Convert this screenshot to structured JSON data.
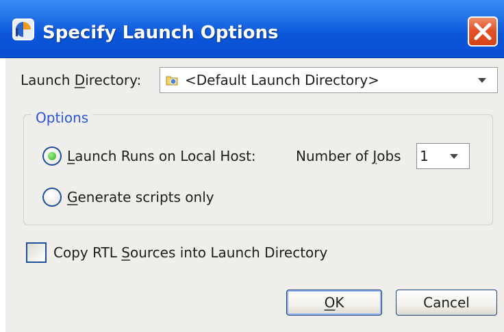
{
  "window": {
    "title": "Specify Launch Options",
    "icons": {
      "app": "app-icon",
      "close": "close-icon"
    }
  },
  "launch_directory": {
    "label_pre": "Launch ",
    "label_mnemonic": "D",
    "label_post": "irectory:",
    "value": "<Default Launch Directory>",
    "icons": {
      "folder": "folder-icon",
      "dropdown": "chevron-down-icon"
    }
  },
  "options": {
    "group_title": "Options",
    "local_host": {
      "selected": true,
      "label_mnemonic": "L",
      "label_post": "aunch Runs on Local Host:"
    },
    "jobs": {
      "label_pre": "Number of ",
      "label_mnemonic": "J",
      "label_post": "obs",
      "value": "1"
    },
    "scripts_only": {
      "selected": false,
      "label_mnemonic": "G",
      "label_post": "enerate scripts only"
    }
  },
  "copy_rtl": {
    "checked": false,
    "label_pre": "Copy RTL ",
    "label_mnemonic": "S",
    "label_post": "ources into Launch Directory"
  },
  "buttons": {
    "ok_mnemonic": "O",
    "ok_post": "K",
    "cancel": "Cancel"
  },
  "colors": {
    "titlebar": "#0a56d9",
    "close_button": "#e2532a",
    "group_title": "#2b55d8",
    "radio_selected": "#2fb21f",
    "dialog_background": "#efeeea"
  }
}
